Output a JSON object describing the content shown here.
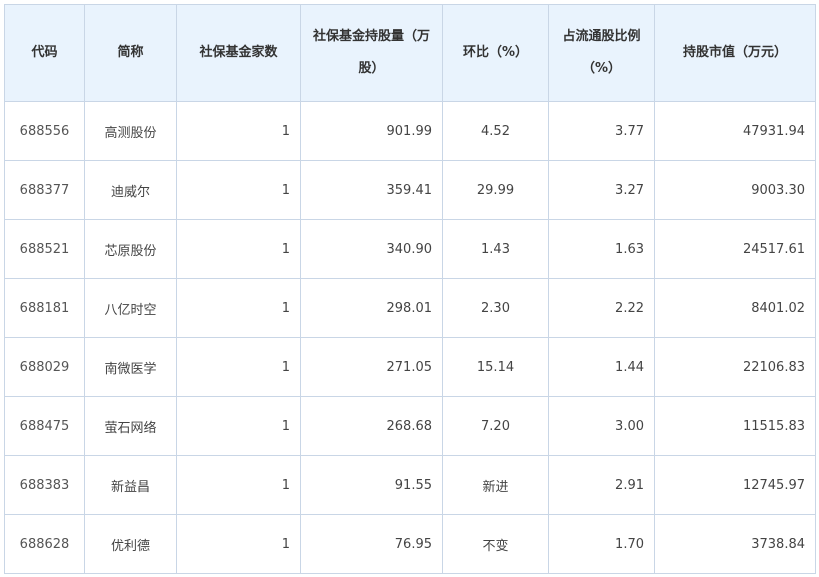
{
  "table": {
    "headers": [
      "代码",
      "简称",
      "社保基金家数",
      "社保基金持股量（万股）",
      "环比（%）",
      "占流通股比例（%）",
      "持股市值（万元）"
    ],
    "rows": [
      [
        "688556",
        "高测股份",
        "1",
        "901.99",
        "4.52",
        "3.77",
        "47931.94"
      ],
      [
        "688377",
        "迪威尔",
        "1",
        "359.41",
        "29.99",
        "3.27",
        "9003.30"
      ],
      [
        "688521",
        "芯原股份",
        "1",
        "340.90",
        "1.43",
        "1.63",
        "24517.61"
      ],
      [
        "688181",
        "八亿时空",
        "1",
        "298.01",
        "2.30",
        "2.22",
        "8401.02"
      ],
      [
        "688029",
        "南微医学",
        "1",
        "271.05",
        "15.14",
        "1.44",
        "22106.83"
      ],
      [
        "688475",
        "萤石网络",
        "1",
        "268.68",
        "7.20",
        "3.00",
        "11515.83"
      ],
      [
        "688383",
        "新益昌",
        "1",
        "91.55",
        "新进",
        "2.91",
        "12745.97"
      ],
      [
        "688628",
        "优利德",
        "1",
        "76.95",
        "不变",
        "1.70",
        "3738.84"
      ]
    ]
  }
}
